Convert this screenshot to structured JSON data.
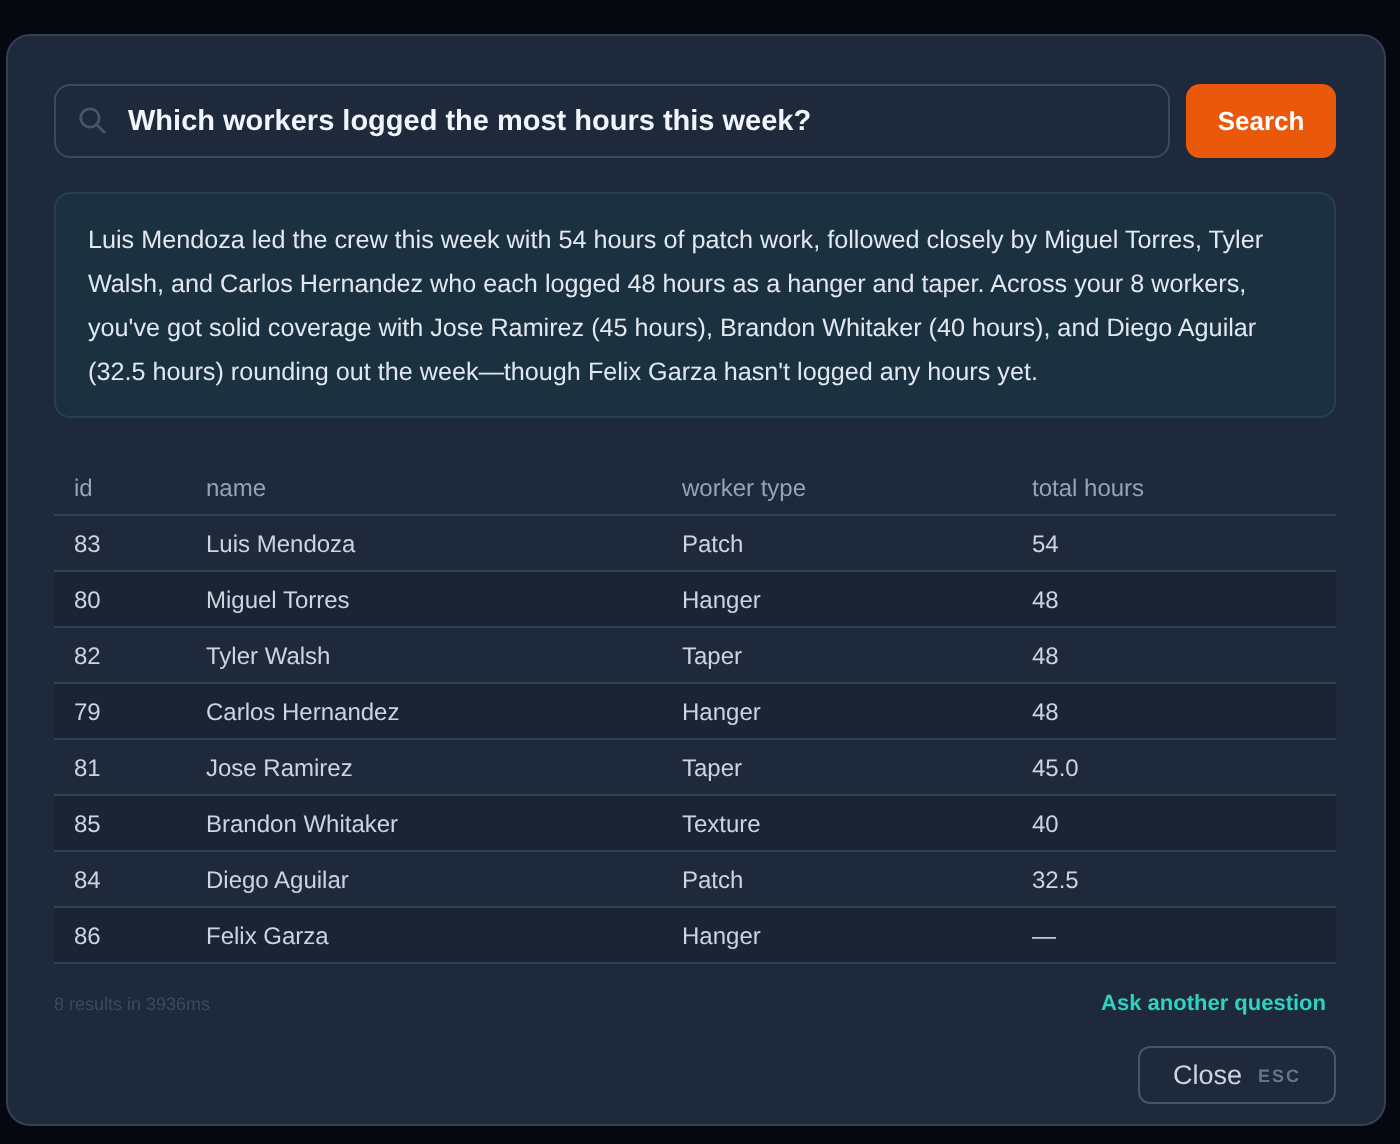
{
  "search": {
    "value": "Which workers logged the most hours this week?",
    "button": "Search"
  },
  "answer": "Luis Mendoza led the crew this week with 54 hours of patch work, followed closely by Miguel Torres, Tyler Walsh, and Carlos Hernandez who each logged 48 hours as a hanger and taper. Across your 8 workers, you've got solid coverage with Jose Ramirez (45 hours), Brandon Whitaker (40 hours), and Diego Aguilar (32.5 hours) rounding out the week—though Felix Garza hasn't logged any hours yet.",
  "table": {
    "columns": [
      "id",
      "name",
      "worker type",
      "total hours"
    ],
    "rows": [
      [
        "83",
        "Luis Mendoza",
        "Patch",
        "54"
      ],
      [
        "80",
        "Miguel Torres",
        "Hanger",
        "48"
      ],
      [
        "82",
        "Tyler Walsh",
        "Taper",
        "48"
      ],
      [
        "79",
        "Carlos Hernandez",
        "Hanger",
        "48"
      ],
      [
        "81",
        "Jose Ramirez",
        "Taper",
        "45.0"
      ],
      [
        "85",
        "Brandon Whitaker",
        "Texture",
        "40"
      ],
      [
        "84",
        "Diego Aguilar",
        "Patch",
        "32.5"
      ],
      [
        "86",
        "Felix Garza",
        "Hanger",
        "—"
      ]
    ]
  },
  "footer": {
    "stats": "8 results in 3936ms",
    "link": "Ask another question"
  },
  "close": {
    "label": "Close",
    "shortcut": "ESC"
  }
}
